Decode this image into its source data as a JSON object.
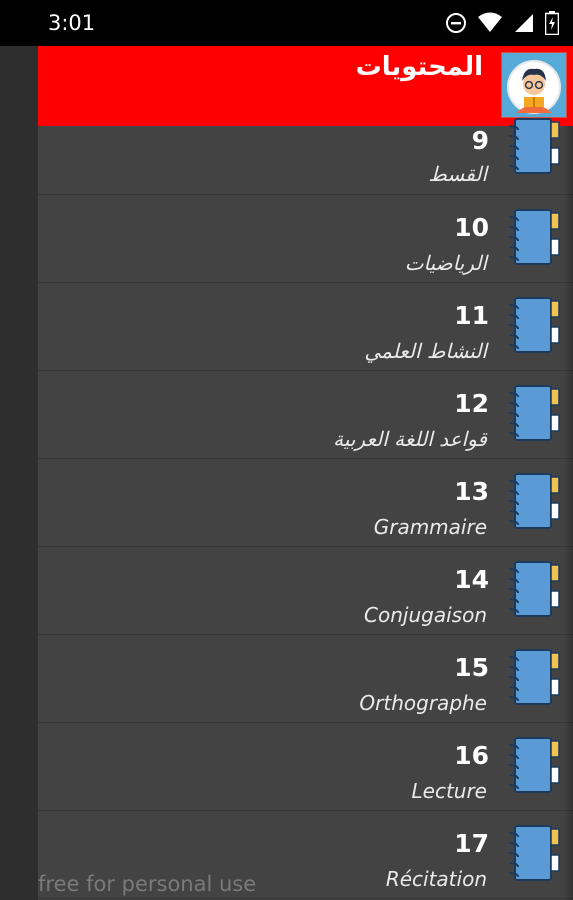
{
  "status_bar": {
    "time": "3:01",
    "icons": [
      "do-not-disturb-icon",
      "wifi-icon",
      "signal-icon",
      "battery-icon"
    ]
  },
  "header": {
    "title": "المحتويات",
    "avatar_icon": "reading-boy-avatar",
    "background_color": "#ff0000"
  },
  "list": {
    "items": [
      {
        "number": "9",
        "label": "القسط"
      },
      {
        "number": "10",
        "label": "الرياضيات"
      },
      {
        "number": "11",
        "label": "النشاط العلمي"
      },
      {
        "number": "12",
        "label": "قواعد اللغة العربية"
      },
      {
        "number": "13",
        "label": "Grammaire"
      },
      {
        "number": "14",
        "label": "Conjugaison"
      },
      {
        "number": "15",
        "label": "Orthographe"
      },
      {
        "number": "16",
        "label": "Lecture"
      },
      {
        "number": "17",
        "label": "Récitation"
      }
    ],
    "item_icon": "notebook-icon"
  },
  "watermark": "free for personal use"
}
